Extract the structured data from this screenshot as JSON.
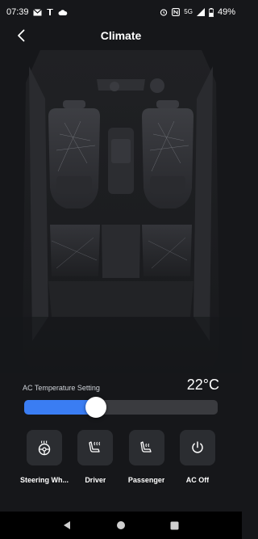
{
  "status_bar": {
    "time": "07:39",
    "network": "5G",
    "battery": "49%"
  },
  "header": {
    "title": "Climate"
  },
  "climate": {
    "temp_label": "AC Temperature Setting",
    "temp_value": "22°C",
    "slider_fraction": 0.37,
    "accent_color": "#3a7df3"
  },
  "controls": [
    {
      "label": "Steering Wh...",
      "icon": "steering-wheel-heat-icon"
    },
    {
      "label": "Driver",
      "icon": "driver-seat-heat-icon"
    },
    {
      "label": "Passenger",
      "icon": "passenger-seat-heat-icon"
    },
    {
      "label": "AC Off",
      "icon": "power-icon"
    }
  ],
  "nav": {
    "back": "back-triangle-icon",
    "home": "home-circle-icon",
    "recents": "recents-square-icon"
  }
}
